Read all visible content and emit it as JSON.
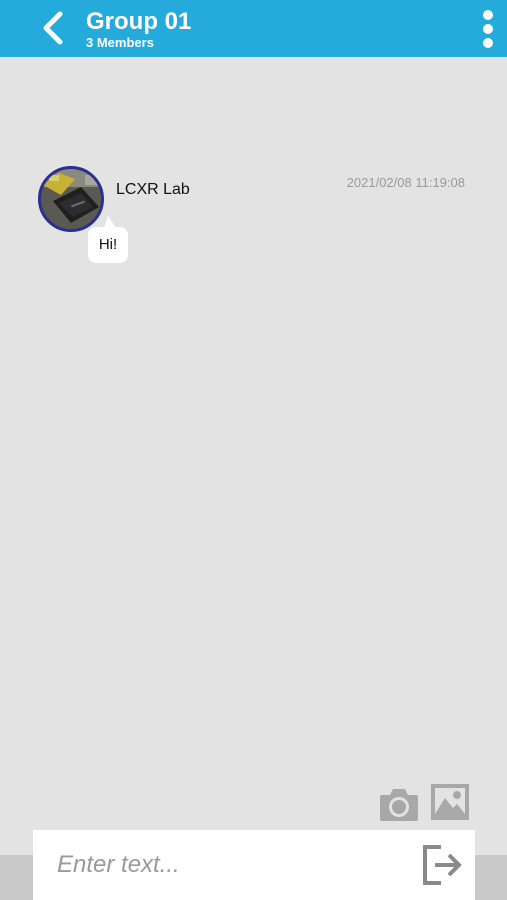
{
  "header": {
    "title": "Group 01",
    "subtitle": "3 Members",
    "back_icon": "chevron-left-icon",
    "menu_icon": "more-vertical-icon",
    "background_color": "#25aadc"
  },
  "messages": [
    {
      "sender": "LCXR Lab",
      "timestamp": "2021/02/08 11:19:08",
      "text": "Hi!",
      "avatar_icon": "avatar-photo"
    }
  ],
  "toolbar": {
    "camera_icon": "camera-icon",
    "image_icon": "image-icon"
  },
  "composer": {
    "placeholder": "Enter text...",
    "value": "",
    "send_icon": "send-exit-icon"
  }
}
